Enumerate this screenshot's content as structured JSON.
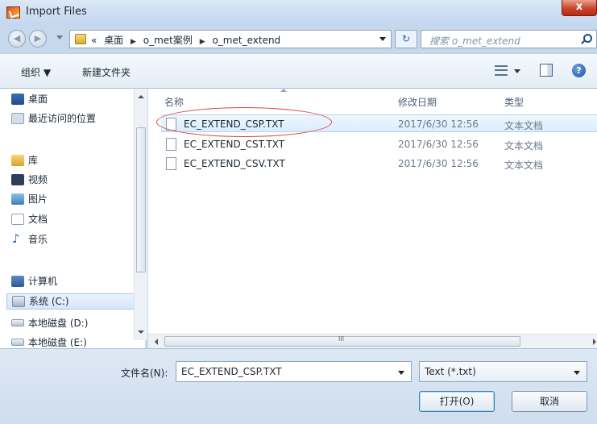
{
  "window": {
    "title": "Import Files",
    "close": "x"
  },
  "navigation": {
    "back": "◀",
    "forward": "▶",
    "breadcrumb": [
      "«",
      "桌面",
      "o_met案例",
      "o_met_extend"
    ],
    "crumb_separator": "▶",
    "refresh": "↻",
    "search_placeholder": "搜索 o_met_extend"
  },
  "toolbar": {
    "organize": "组织 ▼",
    "new_folder": "新建文件夹",
    "help": "?"
  },
  "nav_pane": {
    "items": [
      {
        "label": "桌面",
        "icon": "desktop-icon"
      },
      {
        "label": "最近访问的位置",
        "icon": "recent-places-icon"
      },
      {
        "label": "库",
        "icon": "library-icon"
      },
      {
        "label": "视频",
        "icon": "video-icon"
      },
      {
        "label": "图片",
        "icon": "pictures-icon"
      },
      {
        "label": "文档",
        "icon": "documents-icon"
      },
      {
        "label": "音乐",
        "icon": "music-icon"
      },
      {
        "label": "计算机",
        "icon": "computer-icon"
      },
      {
        "label": "系统 (C:)",
        "icon": "system-drive-icon",
        "selected": true
      },
      {
        "label": "本地磁盘 (D:)",
        "icon": "drive-icon"
      },
      {
        "label": "本地磁盘 (E:)",
        "icon": "drive-icon"
      }
    ]
  },
  "file_list": {
    "columns": {
      "name": "名称",
      "date": "修改日期",
      "type": "类型"
    },
    "rows": [
      {
        "name": "EC_EXTEND_CSP.TXT",
        "date": "2017/6/30 12:56",
        "type": "文本文档",
        "selected": true
      },
      {
        "name": "EC_EXTEND_CST.TXT",
        "date": "2017/6/30 12:56",
        "type": "文本文档"
      },
      {
        "name": "EC_EXTEND_CSV.TXT",
        "date": "2017/6/30 12:56",
        "type": "文本文档"
      }
    ],
    "scroll_grip": "III"
  },
  "footer": {
    "filename_label": "文件名(N):",
    "filename_value": "EC_EXTEND_CSP.TXT",
    "filter_value": "Text (*.txt)",
    "open_label": "打开(O)",
    "cancel_label": "取消"
  },
  "colors": {
    "selection_oval": "#d9443a",
    "window_frame": "#c5d8ec"
  }
}
